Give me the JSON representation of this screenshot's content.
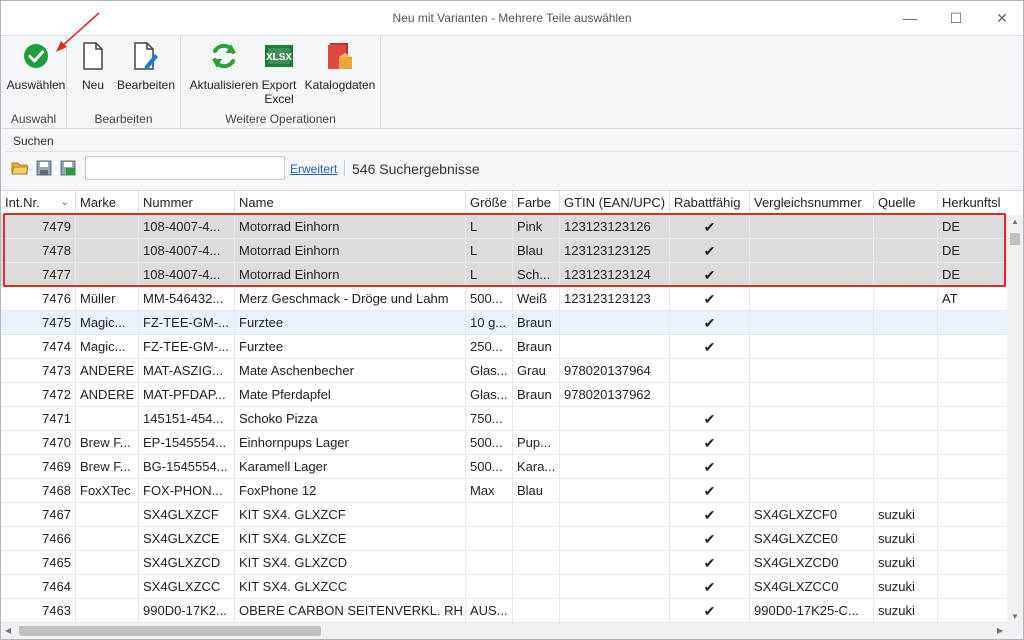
{
  "window": {
    "title": "Neu mit Varianten - Mehrere Teile auswählen",
    "minimize": "—",
    "maximize": "☐",
    "close": "✕"
  },
  "ribbon": {
    "groups": [
      {
        "label": "Auswahl",
        "buttons": [
          {
            "label": "Auswählen",
            "icon": "check-circle-icon"
          }
        ]
      },
      {
        "label": "Bearbeiten",
        "buttons": [
          {
            "label": "Neu",
            "icon": "new-document-icon"
          },
          {
            "label": "Bearbeiten",
            "icon": "edit-document-icon"
          }
        ]
      },
      {
        "label": "Weitere Operationen",
        "buttons": [
          {
            "label": "Aktualisieren",
            "icon": "refresh-icon"
          },
          {
            "label": "Export Excel",
            "icon": "xlsx-icon"
          },
          {
            "label": "Katalogdaten",
            "icon": "catalog-icon"
          }
        ]
      }
    ]
  },
  "search": {
    "header": "Suchen",
    "input_value": "",
    "advanced_link": "Erweitert",
    "result_count": "546 Suchergebnisse"
  },
  "grid": {
    "columns": [
      "Int.Nr.",
      "Marke",
      "Nummer",
      "Name",
      "Größe",
      "Farbe",
      "GTIN (EAN/UPC)",
      "Rabattfähig",
      "Vergleichsnummer",
      "Quelle",
      "Herkunftsl"
    ],
    "checkmark": "✔",
    "rows": [
      {
        "intnr": "7479",
        "marke": "",
        "nummer": "108-4007-4...",
        "name": "Motorrad Einhorn",
        "groesse": "L",
        "farbe": "Pink",
        "gtin": "123123123126",
        "rabatt": true,
        "vergleich": "",
        "quelle": "",
        "herkunft": "DE",
        "selected": true
      },
      {
        "intnr": "7478",
        "marke": "",
        "nummer": "108-4007-4...",
        "name": "Motorrad Einhorn",
        "groesse": "L",
        "farbe": "Blau",
        "gtin": "123123123125",
        "rabatt": true,
        "vergleich": "",
        "quelle": "",
        "herkunft": "DE",
        "selected": true
      },
      {
        "intnr": "7477",
        "marke": "",
        "nummer": "108-4007-4...",
        "name": "Motorrad Einhorn",
        "groesse": "L",
        "farbe": "Sch...",
        "gtin": "123123123124",
        "rabatt": true,
        "vergleich": "",
        "quelle": "",
        "herkunft": "DE",
        "selected": true
      },
      {
        "intnr": "7476",
        "marke": "Müller",
        "nummer": "MM-546432...",
        "name": "Merz Geschmack - Dröge und Lahm",
        "groesse": "500...",
        "farbe": "Weiß",
        "gtin": "123123123123",
        "rabatt": true,
        "vergleich": "",
        "quelle": "",
        "herkunft": "AT"
      },
      {
        "intnr": "7475",
        "marke": "Magic...",
        "nummer": "FZ-TEE-GM-...",
        "name": "Furztee",
        "groesse": "10 g...",
        "farbe": "Braun",
        "gtin": "",
        "rabatt": true,
        "vergleich": "",
        "quelle": "",
        "herkunft": "",
        "hover": true
      },
      {
        "intnr": "7474",
        "marke": "Magic...",
        "nummer": "FZ-TEE-GM-...",
        "name": "Furztee",
        "groesse": "250...",
        "farbe": "Braun",
        "gtin": "",
        "rabatt": true,
        "vergleich": "",
        "quelle": "",
        "herkunft": ""
      },
      {
        "intnr": "7473",
        "marke": "ANDERE",
        "nummer": "MAT-ASZIG...",
        "name": "Mate Aschenbecher",
        "groesse": "Glas...",
        "farbe": "Grau",
        "gtin": "978020137964",
        "rabatt": false,
        "vergleich": "",
        "quelle": "",
        "herkunft": ""
      },
      {
        "intnr": "7472",
        "marke": "ANDERE",
        "nummer": "MAT-PFDAP...",
        "name": "Mate Pferdapfel",
        "groesse": "Glas...",
        "farbe": "Braun",
        "gtin": "978020137962",
        "rabatt": false,
        "vergleich": "",
        "quelle": "",
        "herkunft": ""
      },
      {
        "intnr": "7471",
        "marke": "",
        "nummer": "145151-454...",
        "name": "Schoko Pizza",
        "groesse": "750...",
        "farbe": "",
        "gtin": "",
        "rabatt": true,
        "vergleich": "",
        "quelle": "",
        "herkunft": ""
      },
      {
        "intnr": "7470",
        "marke": "Brew F...",
        "nummer": "EP-1545554...",
        "name": "Einhornpups Lager",
        "groesse": "500...",
        "farbe": "Pup...",
        "gtin": "",
        "rabatt": true,
        "vergleich": "",
        "quelle": "",
        "herkunft": ""
      },
      {
        "intnr": "7469",
        "marke": "Brew F...",
        "nummer": "BG-1545554...",
        "name": "Karamell Lager",
        "groesse": "500...",
        "farbe": "Kara...",
        "gtin": "",
        "rabatt": true,
        "vergleich": "",
        "quelle": "",
        "herkunft": ""
      },
      {
        "intnr": "7468",
        "marke": "FoxXTec",
        "nummer": "FOX-PHON...",
        "name": "FoxPhone 12",
        "groesse": "Max",
        "farbe": "Blau",
        "gtin": "",
        "rabatt": true,
        "vergleich": "",
        "quelle": "",
        "herkunft": ""
      },
      {
        "intnr": "7467",
        "marke": "",
        "nummer": "SX4GLXZCF",
        "name": "KIT SX4. GLXZCF",
        "groesse": "",
        "farbe": "",
        "gtin": "",
        "rabatt": true,
        "vergleich": "SX4GLXZCF0",
        "quelle": "suzuki",
        "herkunft": ""
      },
      {
        "intnr": "7466",
        "marke": "",
        "nummer": "SX4GLXZCE",
        "name": "KIT SX4. GLXZCE",
        "groesse": "",
        "farbe": "",
        "gtin": "",
        "rabatt": true,
        "vergleich": "SX4GLXZCE0",
        "quelle": "suzuki",
        "herkunft": ""
      },
      {
        "intnr": "7465",
        "marke": "",
        "nummer": "SX4GLXZCD",
        "name": "KIT SX4. GLXZCD",
        "groesse": "",
        "farbe": "",
        "gtin": "",
        "rabatt": true,
        "vergleich": "SX4GLXZCD0",
        "quelle": "suzuki",
        "herkunft": ""
      },
      {
        "intnr": "7464",
        "marke": "",
        "nummer": "SX4GLXZCC",
        "name": "KIT SX4. GLXZCC",
        "groesse": "",
        "farbe": "",
        "gtin": "",
        "rabatt": true,
        "vergleich": "SX4GLXZCC0",
        "quelle": "suzuki",
        "herkunft": ""
      },
      {
        "intnr": "7463",
        "marke": "",
        "nummer": "990D0-17K2...",
        "name": "OBERE CARBON SEITENVERKL. RH",
        "groesse": "AUS...",
        "farbe": "",
        "gtin": "",
        "rabatt": true,
        "vergleich": "990D0-17K25-C...",
        "quelle": "suzuki",
        "herkunft": ""
      }
    ]
  },
  "colors": {
    "accent_link": "#1a62c9",
    "selection_outline": "#d32f2f",
    "selected_row": "#dcdcdc",
    "hover_row": "#eaf2fd",
    "ok_green": "#1e9e3a"
  }
}
